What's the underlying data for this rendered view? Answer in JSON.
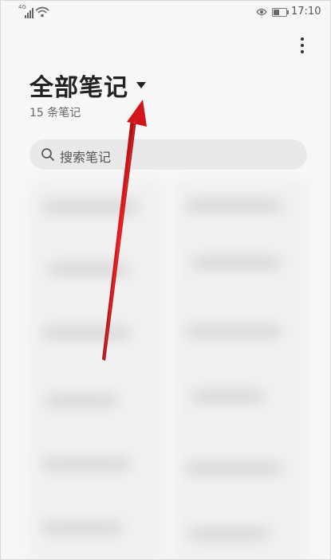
{
  "status_bar": {
    "network": "4G",
    "time": "17:10"
  },
  "header": {
    "title": "全部笔记",
    "note_count": "15 条笔记"
  },
  "search": {
    "placeholder": "搜索笔记"
  },
  "icons": {
    "more": "more-vertical-icon",
    "dropdown": "caret-down-icon",
    "search": "search-icon",
    "eye": "eye-icon",
    "battery": "battery-icon",
    "signal": "signal-icon",
    "wifi": "wifi-icon"
  },
  "colors": {
    "background": "#f7f7f7",
    "search_bg": "#e9e9e9",
    "annotation_arrow": "#d0161b"
  }
}
